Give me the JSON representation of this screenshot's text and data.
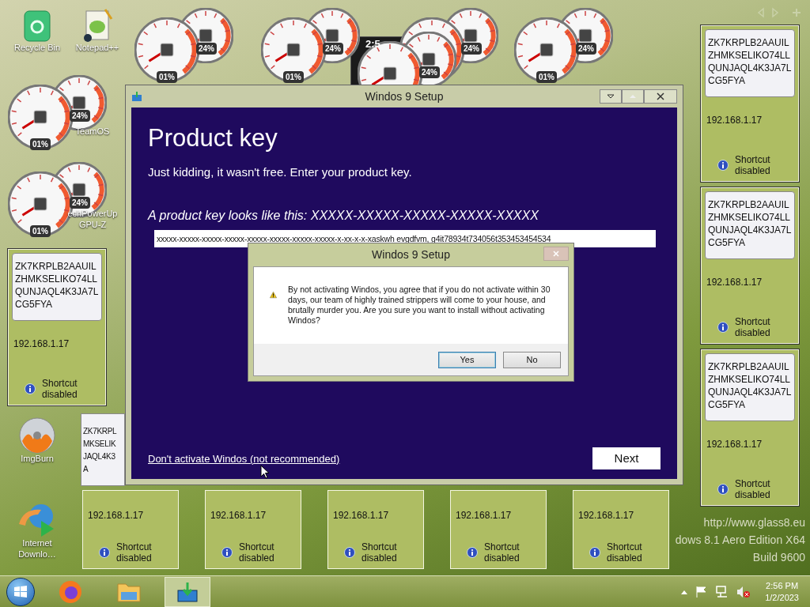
{
  "desktop_icons": [
    {
      "kind": "recycle",
      "label": "Recycle Bin"
    },
    {
      "kind": "notepad",
      "label": "Notepad++"
    },
    {
      "kind": "none",
      "label": "TeamOS"
    },
    {
      "kind": "none",
      "label": "echPowerUp GPU-Z"
    },
    {
      "kind": "disc",
      "label": "ImgBurn"
    },
    {
      "kind": "globe",
      "label": "Internet Downlo…"
    }
  ],
  "gauges": [
    {
      "cpu": "01%",
      "memory": "24%"
    },
    {
      "cpu": "01%",
      "memory": "24%"
    },
    {
      "memory": "24%"
    },
    {
      "cpu": "01%",
      "memory": "24%"
    },
    {
      "cpu": "01%",
      "memory": "24%"
    },
    {
      "cpu": "01%",
      "memory": "24%"
    },
    {
      "memory": "24%"
    }
  ],
  "clock_gadget": {
    "time": "2:5"
  },
  "note_gadgets": [
    {
      "key": "ZK7KRPLB2AAUILZHMKSELIKO74LLQUNJAQL4K3JA7LCG5FYA",
      "ip": "192.168.1.17",
      "status": "Shortcut disabled"
    },
    {
      "key": "ZK7KRPLB2AAUILZHMKSELIKO74LLQUNJAQL4K3JA7LCG5FYA",
      "ip": "192.168.1.17",
      "status": "Shortcut disabled"
    },
    {
      "key": "ZK7KRPLB2AAUILZHMKSELIKO74LLQUNJAQL4K3JA7LCG5FYA",
      "ip": "192.168.1.17",
      "status": "Shortcut disabled"
    },
    {
      "key": "ZK7KRPLB2AAUILZHMKSELIKO74LLQUNJAQL4K3JA7LCG5FYA",
      "ip": "192.168.1.17",
      "status": "Shortcut disabled"
    }
  ],
  "partial_note": {
    "lines": [
      "ZK7KRPL",
      "MKSELIK",
      "JAQL4K3",
      "A"
    ]
  },
  "bottom_gadgets": [
    {
      "ip": "192.168.1.17",
      "status": "Shortcut disabled"
    },
    {
      "ip": "192.168.1.17",
      "status": "Shortcut disabled"
    },
    {
      "ip": "192.168.1.17",
      "status": "Shortcut disabled"
    },
    {
      "ip": "192.168.1.17",
      "status": "Shortcut disabled"
    },
    {
      "ip": "192.168.1.17",
      "status": "Shortcut disabled"
    }
  ],
  "build_info": [
    "http://www.glass8.eu",
    "dows 8.1 Aero Edition X64",
    "Build 9600"
  ],
  "setup_window": {
    "title": "Windos 9 Setup",
    "heading": "Product key",
    "subtitle": "Just kidding, it wasn't free. Enter your product key.",
    "hint": "A product key looks like this: XXXXX-XXXXX-XXXXX-XXXXX-XXXXX",
    "key_value": "xxxxx-xxxxx-xxxxx-xxxxx-xxxxx-xxxxx-xxxxx-xxxxx-x-xx-x-x-xaskwh evgdfvm, g4it78934t734056t353453454534",
    "link": "Don't activate Windos (not recommended)",
    "next_button": "Next"
  },
  "message_box": {
    "title": "Windos 9 Setup",
    "close_disabled": true,
    "message": "By not activating Windos, you agree that if you do not activate within 30 days, our team of highly trained strippers will come to your house, and brutally murder you. Are you sure you want to install without activating Windos?",
    "buttons": [
      {
        "label": "Yes",
        "selected": true
      },
      {
        "label": "No",
        "selected": false
      }
    ]
  },
  "taskbar": {
    "items": [
      {
        "kind": "firefox",
        "selected": false
      },
      {
        "kind": "folder",
        "selected": false
      },
      {
        "kind": "setup",
        "selected": true
      }
    ],
    "time": "2:56 PM",
    "date": "1/2/2023"
  }
}
